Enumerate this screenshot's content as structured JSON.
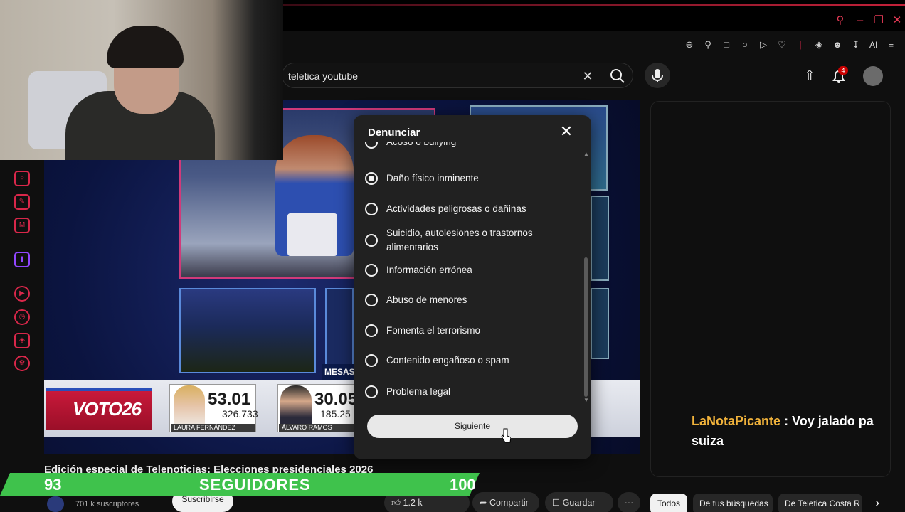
{
  "search": {
    "value": "teletica youtube"
  },
  "header": {
    "notification_count": "4",
    "toolbar_ai_label": "AI"
  },
  "video": {
    "mesas_label": "MESAS E",
    "voto_logo": "VOTO26",
    "candidates": [
      {
        "name": "LAURA FERNÁNDEZ",
        "percent": "53.01",
        "votes": "326.733"
      },
      {
        "name": "ÁLVARO RAMOS",
        "percent": "30.05",
        "votes": "185.25"
      }
    ]
  },
  "modal": {
    "title": "Denunciar",
    "options": [
      {
        "label": "Acoso o bullying",
        "selected": false
      },
      {
        "label": "Daño físico inminente",
        "selected": true
      },
      {
        "label": "Actividades peligrosas o dañinas",
        "selected": false
      },
      {
        "label": "Suicidio, autolesiones o trastornos alimentarios",
        "selected": false
      },
      {
        "label": "Información errónea",
        "selected": false
      },
      {
        "label": "Abuso de menores",
        "selected": false
      },
      {
        "label": "Fomenta el terrorismo",
        "selected": false
      },
      {
        "label": "Contenido engañoso o spam",
        "selected": false
      },
      {
        "label": "Problema legal",
        "selected": false
      }
    ],
    "next_label": "Siguiente"
  },
  "chat": {
    "username": "LaNotaPicante",
    "message": " : Voy jalado pa suiza"
  },
  "below": {
    "video_title": "Edición especial de Telenoticias: Elecciones presidenciales 2026",
    "subscribers": "701 k suscriptores",
    "subscribe_label": "Suscribirse",
    "likes": "1.2 k",
    "share_label": "Compartir",
    "save_label": "Guardar",
    "more_label": "···"
  },
  "overlay": {
    "followers_current": "93",
    "followers_label": "SEGUIDORES",
    "followers_goal": "100",
    "followers_progress": 0.93
  },
  "chips": [
    "Todos",
    "De tus búsquedas",
    "De Teletica Costa R"
  ],
  "colors": {
    "accent": "#d9274a",
    "follower_bar": "#3fc24c",
    "chat_user": "#f0b23b"
  }
}
